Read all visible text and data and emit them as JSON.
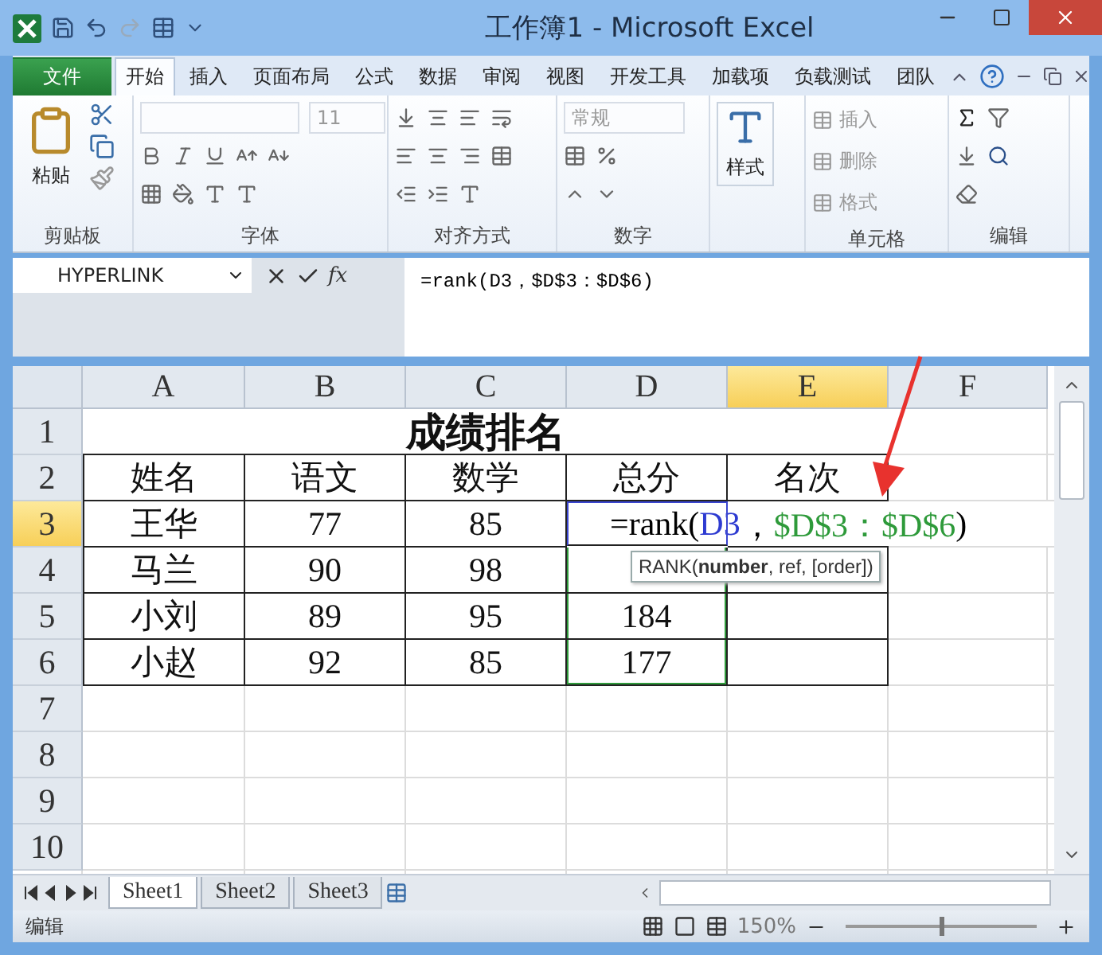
{
  "window": {
    "title": "工作簿1 - Microsoft Excel"
  },
  "ribbon_tabs": [
    {
      "label": "文件",
      "kind": "file",
      "selected": false
    },
    {
      "label": "开始",
      "kind": "tab",
      "selected": true
    },
    {
      "label": "插入",
      "kind": "tab",
      "selected": false
    },
    {
      "label": "页面布局",
      "kind": "tab",
      "selected": false
    },
    {
      "label": "公式",
      "kind": "tab",
      "selected": false
    },
    {
      "label": "数据",
      "kind": "tab",
      "selected": false
    },
    {
      "label": "审阅",
      "kind": "tab",
      "selected": false
    },
    {
      "label": "视图",
      "kind": "tab",
      "selected": false
    },
    {
      "label": "开发工具",
      "kind": "tab",
      "selected": false
    },
    {
      "label": "加载项",
      "kind": "tab",
      "selected": false
    },
    {
      "label": "负载测试",
      "kind": "tab",
      "selected": false
    },
    {
      "label": "团队",
      "kind": "tab",
      "selected": false
    }
  ],
  "ribbon_groups": [
    {
      "kind": "clipboard",
      "label": "剪贴板",
      "button": "粘贴"
    },
    {
      "kind": "font",
      "label": "字体",
      "font_size": "11"
    },
    {
      "kind": "align",
      "label": "对齐方式"
    },
    {
      "kind": "number",
      "label": "数字",
      "format": "常规"
    },
    {
      "kind": "styles",
      "button": "样式"
    },
    {
      "kind": "cells",
      "label": "单元格",
      "commands": [
        "插入",
        "删除",
        "格式"
      ]
    },
    {
      "kind": "editing",
      "label": "编辑"
    }
  ],
  "formula_bar": {
    "name_box": "HYPERLINK",
    "insert_function": "fx",
    "formula": "=rank(D3，$D$3：$D$6)"
  },
  "columns": [
    {
      "label": "A",
      "selected": false
    },
    {
      "label": "B",
      "selected": false
    },
    {
      "label": "C",
      "selected": false
    },
    {
      "label": "D",
      "selected": false
    },
    {
      "label": "E",
      "selected": true
    },
    {
      "label": "F",
      "selected": false
    }
  ],
  "rows": [
    {
      "number": "1",
      "selected": false,
      "kind": "title",
      "title": "成绩排名"
    },
    {
      "number": "2",
      "selected": false,
      "kind": "table",
      "cells": [
        {
          "text": "姓名"
        },
        {
          "text": "语文"
        },
        {
          "text": "数学"
        },
        {
          "text": "总分"
        },
        {
          "text": "名次"
        }
      ]
    },
    {
      "number": "3",
      "selected": true,
      "kind": "table",
      "cells": [
        {
          "text": "王华"
        },
        {
          "text": "77"
        },
        {
          "text": "85"
        },
        {
          "editing": true,
          "referenced": true,
          "parts": [
            {
              "text": "=rank(",
              "color": "#000000"
            },
            {
              "text": "D3",
              "color": "#2e3bd1"
            },
            {
              "text": "，",
              "color": "#000000"
            },
            {
              "text": "$D$3：$D$6",
              "color": "#2e9a3a"
            },
            {
              "text": ")",
              "color": "#000000"
            }
          ]
        }
      ]
    },
    {
      "number": "4",
      "selected": false,
      "kind": "table",
      "cells": [
        {
          "text": "马兰"
        },
        {
          "text": "90"
        },
        {
          "text": "98"
        },
        {
          "referenced": true
        },
        {}
      ]
    },
    {
      "number": "5",
      "selected": false,
      "kind": "table",
      "cells": [
        {
          "text": "小刘"
        },
        {
          "text": "89"
        },
        {
          "text": "95"
        },
        {
          "text": "184",
          "referenced": true
        },
        {}
      ]
    },
    {
      "number": "6",
      "selected": false,
      "kind": "table",
      "cells": [
        {
          "text": "小赵"
        },
        {
          "text": "92"
        },
        {
          "text": "85"
        },
        {
          "text": "177",
          "referenced": true
        },
        {}
      ]
    },
    {
      "number": "7",
      "selected": false,
      "kind": "empty"
    },
    {
      "number": "8",
      "selected": false,
      "kind": "empty"
    },
    {
      "number": "9",
      "selected": false,
      "kind": "empty"
    },
    {
      "number": "10",
      "selected": false,
      "kind": "empty"
    }
  ],
  "tooltip": "RANK(**number**, ref, [order])",
  "sheet_tabs": [
    {
      "label": "Sheet1",
      "selected": true
    },
    {
      "label": "Sheet2",
      "selected": false
    },
    {
      "label": "Sheet3",
      "selected": false
    }
  ],
  "status_bar": {
    "mode": "编辑",
    "zoom": "150%",
    "zoom_slider": {
      "level": 0.5
    }
  }
}
